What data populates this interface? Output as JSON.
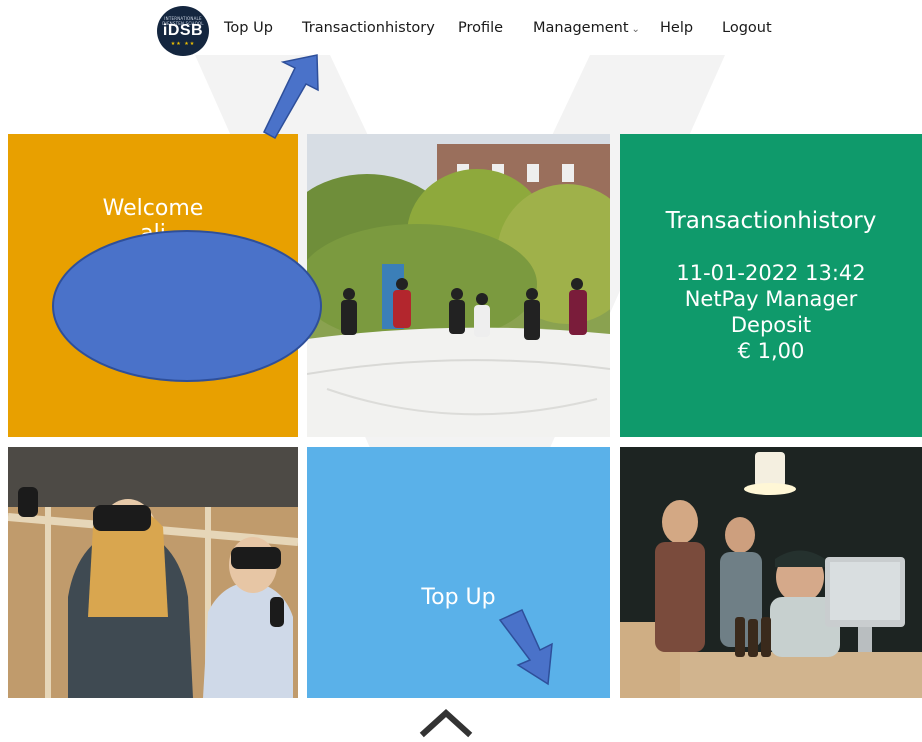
{
  "nav": {
    "logo_top_text": "INTERNATIONALE DIENSTEN SCHOOL",
    "logo_text": "iDSB",
    "logo_stars": "★★ ★★",
    "items": [
      {
        "label": "Top Up"
      },
      {
        "label": "Transactionhistory"
      },
      {
        "label": "Profile"
      },
      {
        "label": "Management",
        "has_dropdown": true
      },
      {
        "label": "Help"
      },
      {
        "label": "Logout"
      }
    ],
    "dropdown_icon": "chevron-down-icon"
  },
  "tiles": {
    "welcome": {
      "title": "Welcome",
      "user": "ali"
    },
    "transaction_history": {
      "title": "Transactionhistory",
      "datetime": "11-01-2022 13:42",
      "merchant": "NetPay Manager",
      "type": "Deposit",
      "amount": "€ 1,00"
    },
    "top_up": {
      "label": "Top Up"
    }
  },
  "colors": {
    "orange": "#e8a000",
    "green": "#0f9a6b",
    "blue": "#5ab1e9",
    "annotation_blue": "#4a72c9"
  },
  "icons": {
    "scroll_top": "chevron-up-icon"
  }
}
